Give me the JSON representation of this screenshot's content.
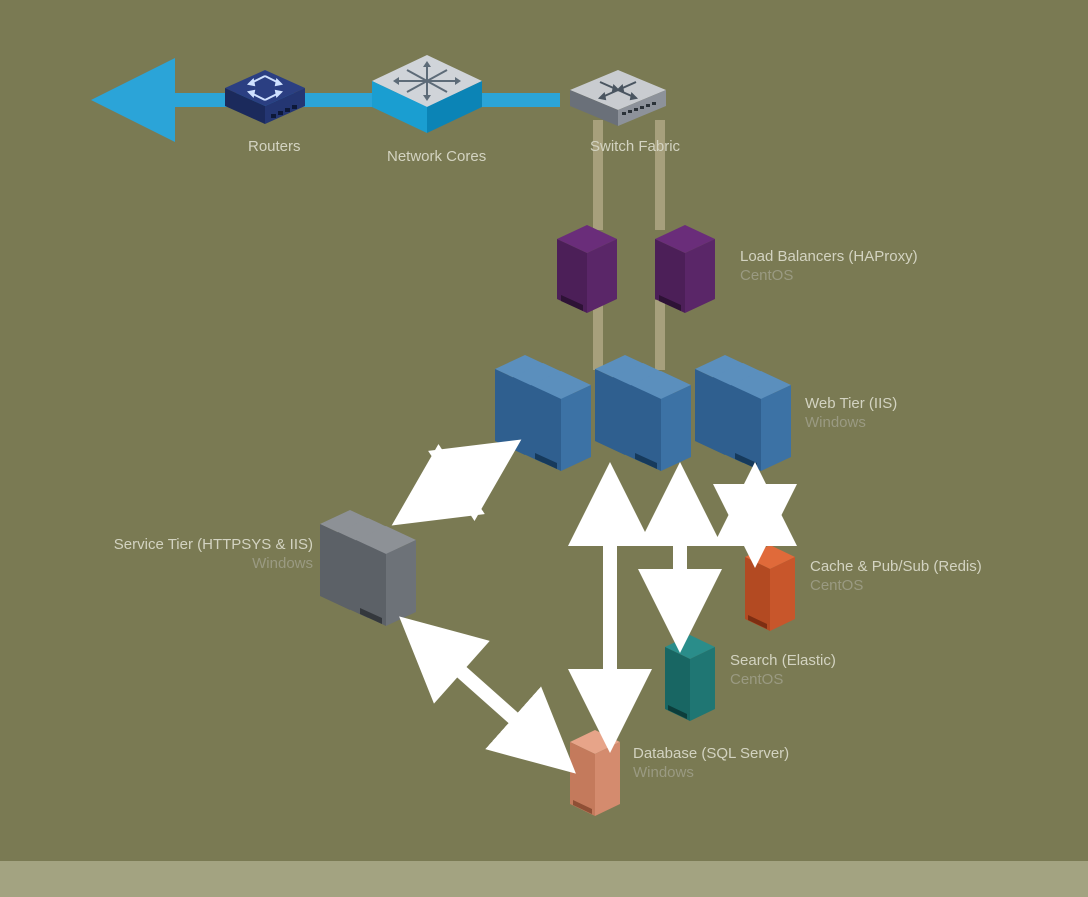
{
  "network": {
    "routers": "Routers",
    "cores": "Network Cores",
    "switch": "Switch Fabric"
  },
  "tiers": {
    "lb": {
      "title": "Load Balancers (HAProxy)",
      "os": "CentOS"
    },
    "web": {
      "title": "Web Tier (IIS)",
      "os": "Windows"
    },
    "service": {
      "title": "Service Tier (HTTPSYS & IIS)",
      "os": "Windows"
    },
    "cache": {
      "title": "Cache & Pub/Sub (Redis)",
      "os": "CentOS"
    },
    "search": {
      "title": "Search (Elastic)",
      "os": "CentOS"
    },
    "db": {
      "title": "Database (SQL Server)",
      "os": "Windows"
    }
  }
}
